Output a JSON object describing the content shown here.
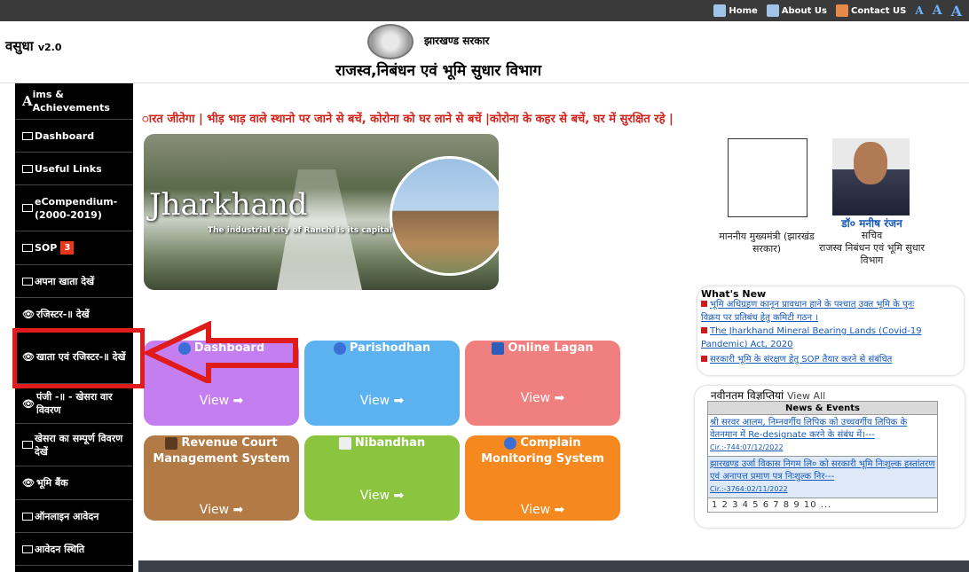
{
  "topbar": {
    "home": "Home",
    "about": "About Us",
    "contact": "Contact US",
    "font_small": "A",
    "font_mid": "A",
    "font_large": "A"
  },
  "header": {
    "brand": "वसुधा",
    "version": "v2.0",
    "state": "झारखण्ड सरकार",
    "department": "राजस्व,निबंधन एवं भूमि सुधार  विभाग"
  },
  "sidebar": {
    "items": [
      {
        "label": "ims & Achievements",
        "prefix": "A"
      },
      {
        "label": "Dashboard"
      },
      {
        "label": "Useful Links"
      },
      {
        "label": "eCompendium-(2000-2019)"
      },
      {
        "label": "SOP",
        "badge": "3"
      },
      {
        "label": "अपना खाता देखें"
      },
      {
        "label": "रजिस्टर-॥ देखें"
      },
      {
        "label": "खाता एवं रजिस्टर-॥ देखें"
      },
      {
        "label": "पंजी -॥ - खेसरा वार विवरण"
      },
      {
        "label": "खेसरा का सम्पूर्ण विवरण देखें"
      },
      {
        "label": "भूमि बैंक"
      },
      {
        "label": "ऑनलाइन आवेदन"
      },
      {
        "label": "आवेदन स्थिति"
      }
    ]
  },
  "marquee": "ारत जीतेगा | भीड़ भाड़ वाले स्थानो पर जाने से बचें, कोरोना को घर लाने से बचें |कोरोना के कहर से बचें, घर में सुरक्षित रहे |",
  "banner": {
    "title": "Jharkhand",
    "subtitle": "The industrial city of Ranchi is its capital"
  },
  "officials": {
    "cm_label": "माननीय मुख्यमंत्री (झारखंड सरकार)",
    "secretary_name": "डॉ० मनीष रंजन",
    "secretary_title": "सचिव",
    "secretary_dept": "राजस्व निबंधन एवं भूमि सुधार विभाग"
  },
  "whats_new": {
    "title": "What's New",
    "items": [
      "भूमि अधिग्रहण कानून प्रावधान हाने के पश्चात् उक्त भूमि के पुनः विक्रय पर प्रतिबंध हेतु कमिटी गठन ।",
      "The Jharkhand Mineral Bearing Lands (Covid-19 Pandemic) Act, 2020",
      "सरकारी भूमि के संरक्षण हेतु SOP तैयार करने से संबंधित"
    ]
  },
  "tiles": [
    {
      "title": "Dashboard",
      "view": "View ➡",
      "color": "#c57ef0"
    },
    {
      "title": "Parishodhan",
      "view": "View ➡",
      "color": "#5bb2ee"
    },
    {
      "title": "Online Lagan",
      "view": "View ➡",
      "color": "#f07f7f"
    },
    {
      "title": "Revenue Court Management System",
      "view": "View ➡",
      "color": "#b27b45"
    },
    {
      "title": "Nibandhan",
      "view": "View ➡",
      "color": "#8bc53f"
    },
    {
      "title": "Complain Monitoring System",
      "view": "View ➡",
      "color": "#f5891f"
    }
  ],
  "notices": {
    "title": "नवीनतम विज्ञप्तियां",
    "view_all": "View All",
    "table_head": "News & Events",
    "rows": [
      {
        "text": "श्री सरवर आलम, निम्नवर्गीय लिपिक को उच्चवर्गीय लिपिक के वेतनमान में Re-designate करने के संबंध में।---",
        "cir": "Cir.:-744:07/12/2022"
      },
      {
        "text": "झारखण्ड उर्जा विकास निगम लि० को सरकारी भूमि निःशुल्क हस्तांतरण एवं अनापत्त प्रमाण पत्र निःशुल्क निर---",
        "cir": "Cir.:-3764:02/11/2022"
      }
    ],
    "pager": "1 2 3 4 5 6 7 8 9 10 ..."
  },
  "colors": {
    "sidebar_bg": "#000000",
    "marquee": "#d0241d",
    "link": "#1659b8",
    "highlight": "#e01b1b"
  }
}
